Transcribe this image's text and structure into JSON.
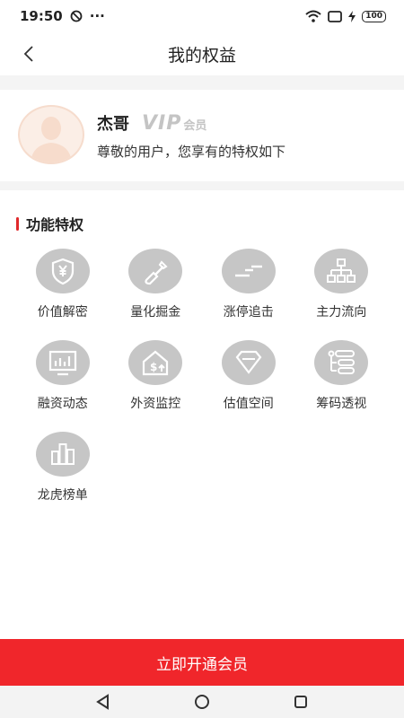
{
  "status_bar": {
    "time": "19:50",
    "dots": "···",
    "battery": "100"
  },
  "header": {
    "title": "我的权益"
  },
  "profile": {
    "name": "杰哥",
    "vip_mark": "VIP",
    "vip_tag": "会员",
    "subtitle": "尊敬的用户，您享有的特权如下"
  },
  "section": {
    "title": "功能特权"
  },
  "features": [
    {
      "label": "价值解密",
      "icon": "yen-shield-icon"
    },
    {
      "label": "量化掘金",
      "icon": "shovel-icon"
    },
    {
      "label": "涨停追击",
      "icon": "lines-icon"
    },
    {
      "label": "主力流向",
      "icon": "org-chart-icon"
    },
    {
      "label": "融资动态",
      "icon": "monitor-chart-icon"
    },
    {
      "label": "外资监控",
      "icon": "house-dollar-icon"
    },
    {
      "label": "估值空间",
      "icon": "diamond-icon"
    },
    {
      "label": "筹码透视",
      "icon": "slider-list-icon"
    },
    {
      "label": "龙虎榜单",
      "icon": "bar-columns-icon"
    }
  ],
  "cta": {
    "label": "立即开通会员"
  },
  "colors": {
    "accent": "#f0262b",
    "icon_bg": "#c6c6c6"
  }
}
